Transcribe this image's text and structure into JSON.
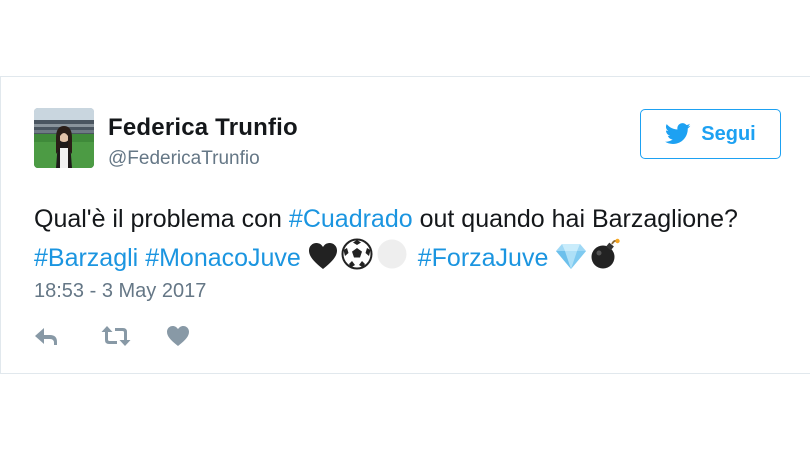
{
  "tweet": {
    "author_name": "Federica Trunfio",
    "author_handle": "@FedericaTrunfio",
    "follow_label": "Segui",
    "text_line1_prefix": "Qual'è il problema con ",
    "hashtag_cuadrado": "#Cuadrado",
    "text_line1_suffix": " out quando hai Barzaglione?",
    "hashtag_barzagli": "#Barzagli",
    "hashtag_monacojuve": "#MonacoJuve",
    "hashtag_forzajuve": "#ForzaJuve",
    "timestamp": "18:53 - 3 May 2017"
  },
  "icons": {
    "follow": "twitter-bird-icon",
    "reply": "reply-icon",
    "retweet": "retweet-icon",
    "like": "heart-icon",
    "emojis": [
      "black-heart-icon",
      "soccer-ball-icon",
      "white-circle-icon",
      "diamond-icon",
      "bomb-icon"
    ]
  },
  "colors": {
    "accent": "#1da1f2",
    "hashtag": "#1b95e0",
    "text": "#14171a",
    "muted": "#657786",
    "action_icon": "#8899a6"
  }
}
